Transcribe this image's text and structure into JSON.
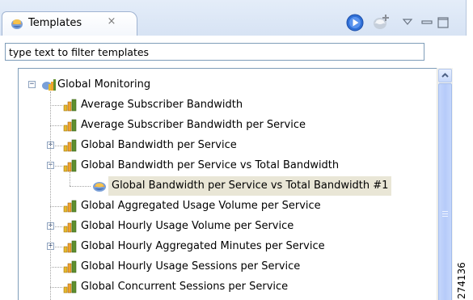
{
  "view": {
    "tab_title": "Templates",
    "close_glyph": "×",
    "accent": "#d7e3f4"
  },
  "filter": {
    "placeholder": "type text to filter templates"
  },
  "tree": {
    "root": {
      "label": "Global Monitoring",
      "expanded": true,
      "icon": "group-report-icon"
    },
    "items": [
      {
        "label": "Average Subscriber Bandwidth",
        "icon": "report-icon",
        "expander": "none"
      },
      {
        "label": "Average Subscriber Bandwidth per Service",
        "icon": "report-icon",
        "expander": "none"
      },
      {
        "label": "Global Bandwidth per Service",
        "icon": "report-icon",
        "expander": "plus"
      },
      {
        "label": "Global Bandwidth per Service vs Total Bandwidth",
        "icon": "report-icon",
        "expander": "minus"
      },
      {
        "label": "Global Bandwidth per Service vs Total Bandwidth #1",
        "icon": "instance-icon",
        "expander": "none",
        "child": true,
        "selected": true
      },
      {
        "label": "Global Aggregated Usage Volume per Service",
        "icon": "report-icon",
        "expander": "none"
      },
      {
        "label": "Global Hourly Usage Volume per Service",
        "icon": "report-icon",
        "expander": "plus"
      },
      {
        "label": "Global Hourly Aggregated Minutes per Service",
        "icon": "report-icon",
        "expander": "plus"
      },
      {
        "label": "Global Hourly Usage Sessions per Service",
        "icon": "report-icon",
        "expander": "none"
      },
      {
        "label": "Global Concurrent Sessions per Service",
        "icon": "report-icon",
        "expander": "none"
      }
    ]
  },
  "side_code": "274136"
}
